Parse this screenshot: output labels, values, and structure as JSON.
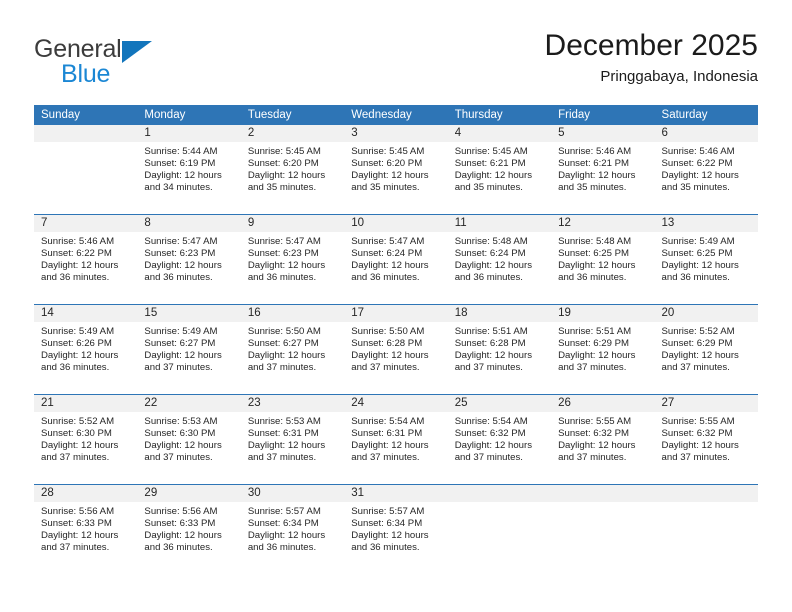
{
  "brand": {
    "name_part1": "General",
    "name_part2": "Blue",
    "triangle_icon": "triangle-icon",
    "accent_color": "#1b87d4",
    "dark_color": "#3c3c3c"
  },
  "header": {
    "month_title": "December 2025",
    "location": "Pringgabaya, Indonesia"
  },
  "calendar": {
    "header_color": "#2e75b6",
    "daynum_band_color": "#f1f1f1",
    "weekdays": [
      "Sunday",
      "Monday",
      "Tuesday",
      "Wednesday",
      "Thursday",
      "Friday",
      "Saturday"
    ],
    "weeks": [
      [
        {
          "day": "",
          "sunrise": "",
          "sunset": "",
          "daylight1": "",
          "daylight2": "",
          "empty": true
        },
        {
          "day": "1",
          "sunrise": "Sunrise: 5:44 AM",
          "sunset": "Sunset: 6:19 PM",
          "daylight1": "Daylight: 12 hours",
          "daylight2": "and 34 minutes."
        },
        {
          "day": "2",
          "sunrise": "Sunrise: 5:45 AM",
          "sunset": "Sunset: 6:20 PM",
          "daylight1": "Daylight: 12 hours",
          "daylight2": "and 35 minutes."
        },
        {
          "day": "3",
          "sunrise": "Sunrise: 5:45 AM",
          "sunset": "Sunset: 6:20 PM",
          "daylight1": "Daylight: 12 hours",
          "daylight2": "and 35 minutes."
        },
        {
          "day": "4",
          "sunrise": "Sunrise: 5:45 AM",
          "sunset": "Sunset: 6:21 PM",
          "daylight1": "Daylight: 12 hours",
          "daylight2": "and 35 minutes."
        },
        {
          "day": "5",
          "sunrise": "Sunrise: 5:46 AM",
          "sunset": "Sunset: 6:21 PM",
          "daylight1": "Daylight: 12 hours",
          "daylight2": "and 35 minutes."
        },
        {
          "day": "6",
          "sunrise": "Sunrise: 5:46 AM",
          "sunset": "Sunset: 6:22 PM",
          "daylight1": "Daylight: 12 hours",
          "daylight2": "and 35 minutes."
        }
      ],
      [
        {
          "day": "7",
          "sunrise": "Sunrise: 5:46 AM",
          "sunset": "Sunset: 6:22 PM",
          "daylight1": "Daylight: 12 hours",
          "daylight2": "and 36 minutes."
        },
        {
          "day": "8",
          "sunrise": "Sunrise: 5:47 AM",
          "sunset": "Sunset: 6:23 PM",
          "daylight1": "Daylight: 12 hours",
          "daylight2": "and 36 minutes."
        },
        {
          "day": "9",
          "sunrise": "Sunrise: 5:47 AM",
          "sunset": "Sunset: 6:23 PM",
          "daylight1": "Daylight: 12 hours",
          "daylight2": "and 36 minutes."
        },
        {
          "day": "10",
          "sunrise": "Sunrise: 5:47 AM",
          "sunset": "Sunset: 6:24 PM",
          "daylight1": "Daylight: 12 hours",
          "daylight2": "and 36 minutes."
        },
        {
          "day": "11",
          "sunrise": "Sunrise: 5:48 AM",
          "sunset": "Sunset: 6:24 PM",
          "daylight1": "Daylight: 12 hours",
          "daylight2": "and 36 minutes."
        },
        {
          "day": "12",
          "sunrise": "Sunrise: 5:48 AM",
          "sunset": "Sunset: 6:25 PM",
          "daylight1": "Daylight: 12 hours",
          "daylight2": "and 36 minutes."
        },
        {
          "day": "13",
          "sunrise": "Sunrise: 5:49 AM",
          "sunset": "Sunset: 6:25 PM",
          "daylight1": "Daylight: 12 hours",
          "daylight2": "and 36 minutes."
        }
      ],
      [
        {
          "day": "14",
          "sunrise": "Sunrise: 5:49 AM",
          "sunset": "Sunset: 6:26 PM",
          "daylight1": "Daylight: 12 hours",
          "daylight2": "and 36 minutes."
        },
        {
          "day": "15",
          "sunrise": "Sunrise: 5:49 AM",
          "sunset": "Sunset: 6:27 PM",
          "daylight1": "Daylight: 12 hours",
          "daylight2": "and 37 minutes."
        },
        {
          "day": "16",
          "sunrise": "Sunrise: 5:50 AM",
          "sunset": "Sunset: 6:27 PM",
          "daylight1": "Daylight: 12 hours",
          "daylight2": "and 37 minutes."
        },
        {
          "day": "17",
          "sunrise": "Sunrise: 5:50 AM",
          "sunset": "Sunset: 6:28 PM",
          "daylight1": "Daylight: 12 hours",
          "daylight2": "and 37 minutes."
        },
        {
          "day": "18",
          "sunrise": "Sunrise: 5:51 AM",
          "sunset": "Sunset: 6:28 PM",
          "daylight1": "Daylight: 12 hours",
          "daylight2": "and 37 minutes."
        },
        {
          "day": "19",
          "sunrise": "Sunrise: 5:51 AM",
          "sunset": "Sunset: 6:29 PM",
          "daylight1": "Daylight: 12 hours",
          "daylight2": "and 37 minutes."
        },
        {
          "day": "20",
          "sunrise": "Sunrise: 5:52 AM",
          "sunset": "Sunset: 6:29 PM",
          "daylight1": "Daylight: 12 hours",
          "daylight2": "and 37 minutes."
        }
      ],
      [
        {
          "day": "21",
          "sunrise": "Sunrise: 5:52 AM",
          "sunset": "Sunset: 6:30 PM",
          "daylight1": "Daylight: 12 hours",
          "daylight2": "and 37 minutes."
        },
        {
          "day": "22",
          "sunrise": "Sunrise: 5:53 AM",
          "sunset": "Sunset: 6:30 PM",
          "daylight1": "Daylight: 12 hours",
          "daylight2": "and 37 minutes."
        },
        {
          "day": "23",
          "sunrise": "Sunrise: 5:53 AM",
          "sunset": "Sunset: 6:31 PM",
          "daylight1": "Daylight: 12 hours",
          "daylight2": "and 37 minutes."
        },
        {
          "day": "24",
          "sunrise": "Sunrise: 5:54 AM",
          "sunset": "Sunset: 6:31 PM",
          "daylight1": "Daylight: 12 hours",
          "daylight2": "and 37 minutes."
        },
        {
          "day": "25",
          "sunrise": "Sunrise: 5:54 AM",
          "sunset": "Sunset: 6:32 PM",
          "daylight1": "Daylight: 12 hours",
          "daylight2": "and 37 minutes."
        },
        {
          "day": "26",
          "sunrise": "Sunrise: 5:55 AM",
          "sunset": "Sunset: 6:32 PM",
          "daylight1": "Daylight: 12 hours",
          "daylight2": "and 37 minutes."
        },
        {
          "day": "27",
          "sunrise": "Sunrise: 5:55 AM",
          "sunset": "Sunset: 6:32 PM",
          "daylight1": "Daylight: 12 hours",
          "daylight2": "and 37 minutes."
        }
      ],
      [
        {
          "day": "28",
          "sunrise": "Sunrise: 5:56 AM",
          "sunset": "Sunset: 6:33 PM",
          "daylight1": "Daylight: 12 hours",
          "daylight2": "and 37 minutes."
        },
        {
          "day": "29",
          "sunrise": "Sunrise: 5:56 AM",
          "sunset": "Sunset: 6:33 PM",
          "daylight1": "Daylight: 12 hours",
          "daylight2": "and 36 minutes."
        },
        {
          "day": "30",
          "sunrise": "Sunrise: 5:57 AM",
          "sunset": "Sunset: 6:34 PM",
          "daylight1": "Daylight: 12 hours",
          "daylight2": "and 36 minutes."
        },
        {
          "day": "31",
          "sunrise": "Sunrise: 5:57 AM",
          "sunset": "Sunset: 6:34 PM",
          "daylight1": "Daylight: 12 hours",
          "daylight2": "and 36 minutes."
        },
        {
          "day": "",
          "sunrise": "",
          "sunset": "",
          "daylight1": "",
          "daylight2": "",
          "empty": true
        },
        {
          "day": "",
          "sunrise": "",
          "sunset": "",
          "daylight1": "",
          "daylight2": "",
          "empty": true
        },
        {
          "day": "",
          "sunrise": "",
          "sunset": "",
          "daylight1": "",
          "daylight2": "",
          "empty": true
        }
      ]
    ]
  }
}
